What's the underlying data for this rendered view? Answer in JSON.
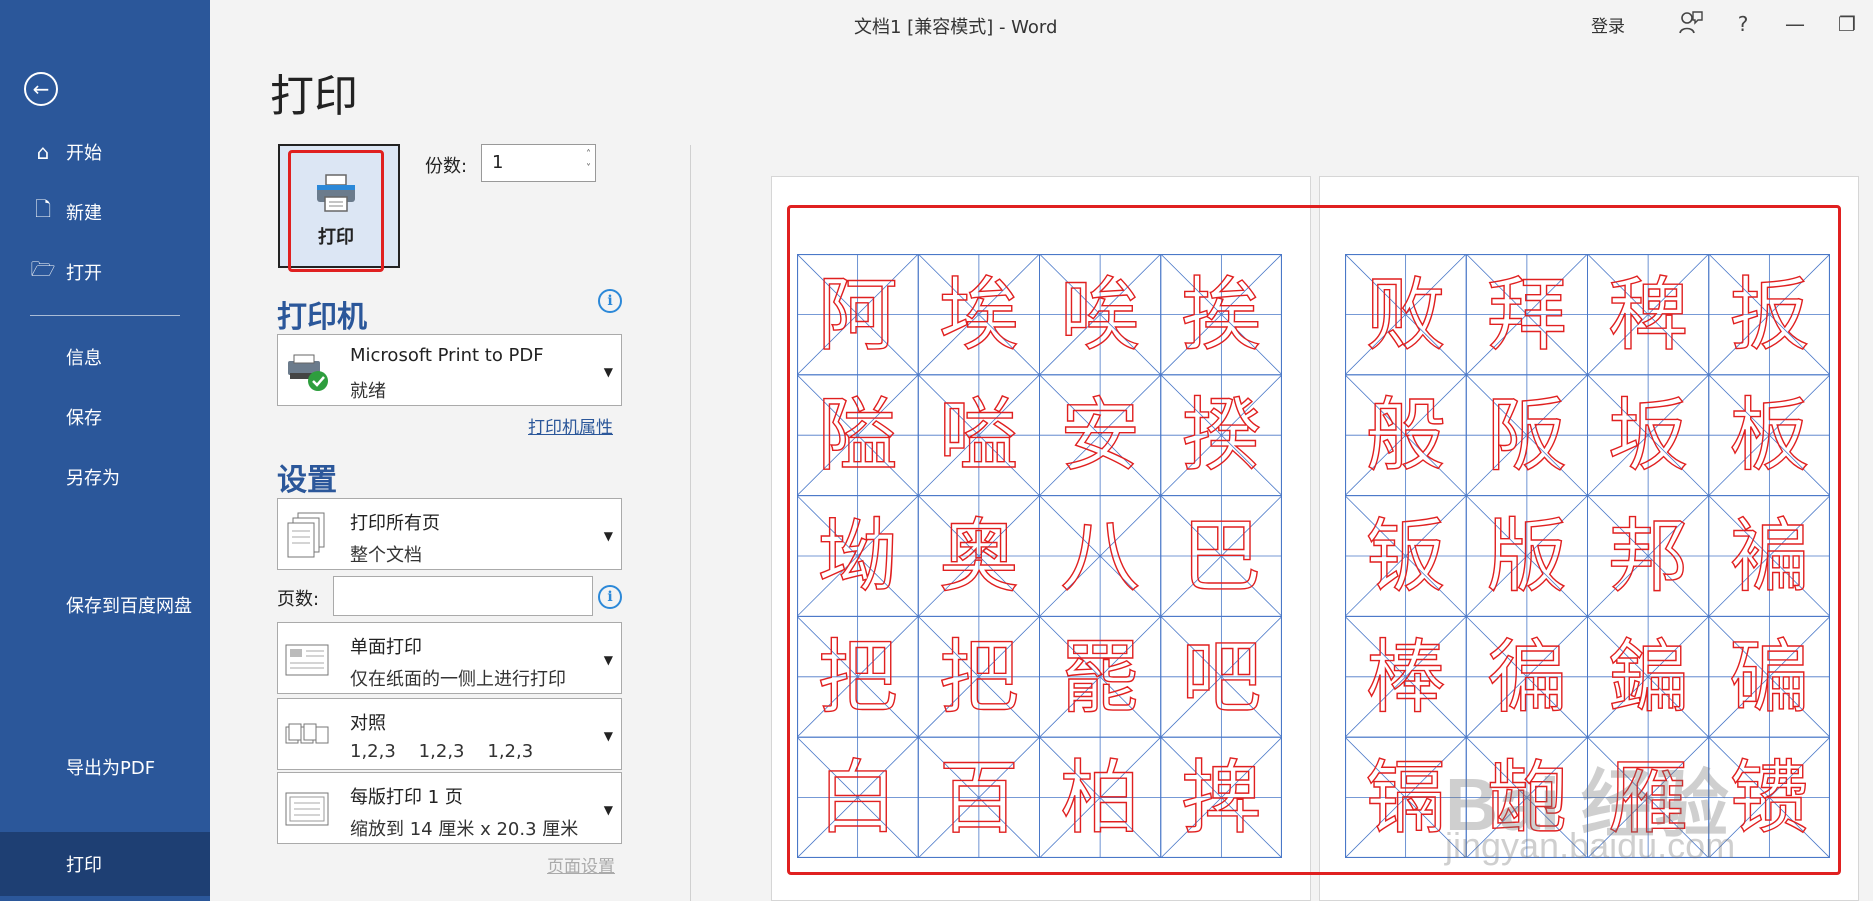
{
  "window": {
    "title": "文档1 [兼容模式]  -  Word",
    "login_label": "登录",
    "help_label": "?"
  },
  "sidebar": {
    "back_icon": "back-arrow-icon",
    "items": [
      {
        "label": "开始",
        "icon": "home-icon"
      },
      {
        "label": "新建",
        "icon": "new-doc-icon"
      },
      {
        "label": "打开",
        "icon": "open-folder-icon"
      },
      {
        "label": "信息"
      },
      {
        "label": "保存"
      },
      {
        "label": "另存为"
      },
      {
        "label": "保存到百度网盘"
      },
      {
        "label": "导出为PDF"
      },
      {
        "label": "打印",
        "active": true
      }
    ]
  },
  "print": {
    "page_title": "打印",
    "print_button_label": "打印",
    "copies_label": "份数:",
    "copies_value": "1",
    "printer_section_title": "打印机",
    "printer_name": "Microsoft Print to PDF",
    "printer_status": "就绪",
    "printer_properties_link": "打印机属性",
    "settings_section_title": "设置",
    "setting_pages": {
      "main": "打印所有页",
      "sub": "整个文档"
    },
    "pages_label": "页数:",
    "pages_value": "",
    "setting_sides": {
      "main": "单面打印",
      "sub": "仅在纸面的一侧上进行打印"
    },
    "setting_collate": {
      "main": "对照",
      "sub": "1,2,3    1,2,3    1,2,3"
    },
    "setting_per_sheet": {
      "main": "每版打印 1 页",
      "sub": "缩放到 14 厘米 x 20.3 厘米"
    },
    "page_setup_link": "页面设置"
  },
  "preview": {
    "page1_chars": [
      "阿",
      "埃",
      "唉",
      "挨",
      "隘",
      "嗌",
      "安",
      "揆",
      "坳",
      "奥",
      "八",
      "巴",
      "把",
      "把",
      "罷",
      "吧",
      "白",
      "百",
      "柏",
      "捭"
    ],
    "page2_chars": [
      "败",
      "拜",
      "稗",
      "扳",
      "般",
      "阪",
      "坂",
      "板",
      "钣",
      "版",
      "邦",
      "褊",
      "棒",
      "徧",
      "鍽",
      "碥",
      "镉",
      "龅",
      "雁",
      "镄"
    ],
    "grid_color": "#4a78c8",
    "char_color": "#e02020",
    "watermark_main": "Bai 经验",
    "watermark_sub": "jingyan.baidu.com"
  },
  "colors": {
    "sidebar_bg": "#2b579a",
    "active_bg": "#1e3f73",
    "highlight_red": "#e02020"
  }
}
